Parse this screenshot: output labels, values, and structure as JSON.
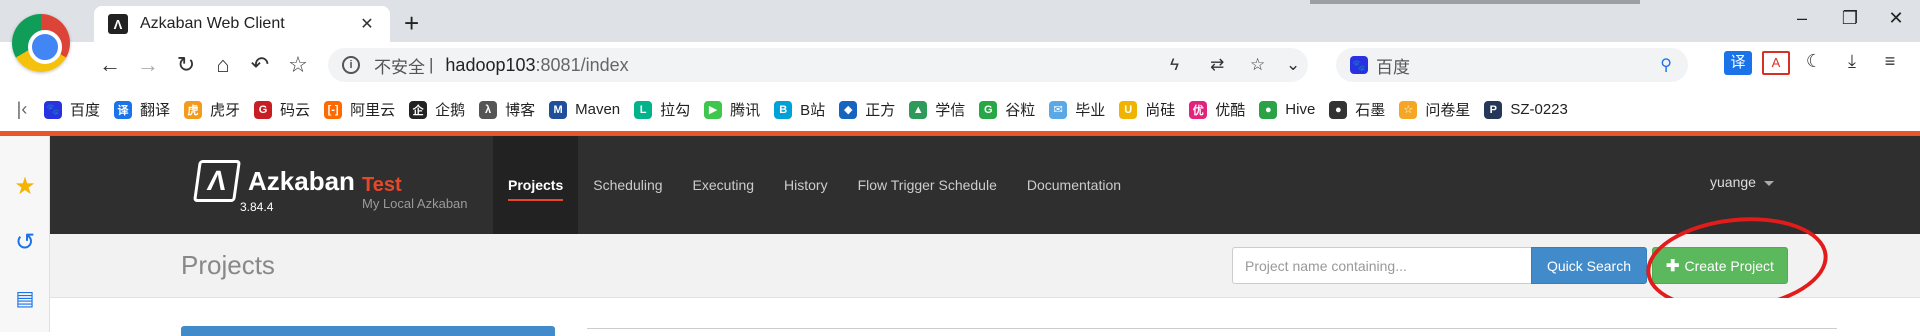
{
  "browser": {
    "tab": {
      "favicon": "azkaban-favicon",
      "title": "Azkaban Web Client"
    },
    "new_tab_label": "+",
    "address": {
      "security": "不安全",
      "separator": "|",
      "host": "hadoop103",
      "port": ":8081/index"
    },
    "search": {
      "engine_icon": "baidu-paw-icon",
      "placeholder": "百度"
    },
    "window_controls": {
      "minimize": "–",
      "restore": "❐",
      "close": "✕"
    }
  },
  "bookmarks": [
    {
      "label": "百度",
      "color": "#2932e1",
      "glyph": "🐾"
    },
    {
      "label": "翻译",
      "color": "#1a73e8",
      "glyph": "译"
    },
    {
      "label": "虎牙",
      "color": "#f29b1d",
      "glyph": "虎"
    },
    {
      "label": "码云",
      "color": "#c71d23",
      "glyph": "G"
    },
    {
      "label": "阿里云",
      "color": "#ff6a00",
      "glyph": "[-]"
    },
    {
      "label": "企鹅",
      "color": "#222222",
      "glyph": "企"
    },
    {
      "label": "博客",
      "color": "#555555",
      "glyph": "λ"
    },
    {
      "label": "Maven",
      "color": "#1f4e9b",
      "glyph": "M"
    },
    {
      "label": "拉勾",
      "color": "#00b38a",
      "glyph": "L"
    },
    {
      "label": "腾讯",
      "color": "#3ec74c",
      "glyph": "▶"
    },
    {
      "label": "B站",
      "color": "#00a1d6",
      "glyph": "B"
    },
    {
      "label": "正方",
      "color": "#1565c0",
      "glyph": "◆"
    },
    {
      "label": "学信",
      "color": "#2e9b5a",
      "glyph": "▲"
    },
    {
      "label": "谷粒",
      "color": "#27a745",
      "glyph": "G"
    },
    {
      "label": "毕业",
      "color": "#5aa9e6",
      "glyph": "✉"
    },
    {
      "label": "尚硅",
      "color": "#f0b400",
      "glyph": "U"
    },
    {
      "label": "优酷",
      "color": "#e3227c",
      "glyph": "优"
    },
    {
      "label": "Hive",
      "color": "#2ba245",
      "glyph": "●"
    },
    {
      "label": "石墨",
      "color": "#333333",
      "glyph": "●"
    },
    {
      "label": "问卷星",
      "color": "#f5a623",
      "glyph": "☆"
    },
    {
      "label": "SZ-0223",
      "color": "#253858",
      "glyph": "P"
    }
  ],
  "azkaban": {
    "brand": "Azkaban",
    "version": "3.84.4",
    "env_name": "Test",
    "env_desc": "My Local Azkaban",
    "nav": [
      {
        "label": "Projects",
        "active": true
      },
      {
        "label": "Scheduling",
        "active": false
      },
      {
        "label": "Executing",
        "active": false
      },
      {
        "label": "History",
        "active": false
      },
      {
        "label": "Flow Trigger Schedule",
        "active": false
      },
      {
        "label": "Documentation",
        "active": false
      }
    ],
    "user": "yuange",
    "page_title": "Projects",
    "search_placeholder": "Project name containing...",
    "quick_search_label": "Quick Search",
    "create_project_label": "Create Project",
    "colors": {
      "accent": "#e8472a",
      "header": "#2f2f2f",
      "primary": "#428bca",
      "success": "#5cb85c",
      "annotation": "#e21b1b"
    }
  }
}
